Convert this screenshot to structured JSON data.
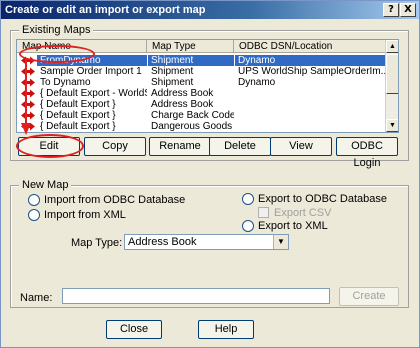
{
  "window": {
    "title": "Create or edit an import or export map",
    "help_label": "?",
    "close_label": "X"
  },
  "existing_maps": {
    "legend": "Existing Maps",
    "columns": [
      "Map Name",
      "Map Type",
      "ODBC DSN/Location"
    ],
    "rows": [
      {
        "name": "FromDynamo",
        "type": "Shipment",
        "location": "Dynamo",
        "selected": true
      },
      {
        "name": "Sample Order Import 1",
        "type": "Shipment",
        "location": "UPS WorldShip SampleOrderIm...",
        "selected": false
      },
      {
        "name": "To Dynamo",
        "type": "Shipment",
        "location": "Dynamo",
        "selected": false
      },
      {
        "name": "{ Default Export - WorldShip }",
        "type": "Address Book",
        "location": "",
        "selected": false
      },
      {
        "name": "{ Default Export }",
        "type": "Address Book",
        "location": "",
        "selected": false
      },
      {
        "name": "{ Default Export }",
        "type": "Charge Back Code",
        "location": "",
        "selected": false
      },
      {
        "name": "{ Default Export }",
        "type": "Dangerous Goods",
        "location": "",
        "selected": false
      }
    ],
    "buttons": {
      "edit": "Edit",
      "copy": "Copy",
      "rename": "Rename",
      "delete": "Delete",
      "view": "View",
      "odbc_login": "ODBC Login"
    }
  },
  "new_map": {
    "legend": "New Map",
    "import_odbc": "Import from ODBC Database",
    "import_xml": "Import from XML",
    "export_odbc": "Export to ODBC Database",
    "export_csv": "Export CSV",
    "export_xml": "Export to XML",
    "map_type_label": "Map Type:",
    "map_type_value": "Address Book",
    "name_label": "Name:",
    "name_value": "",
    "create_label": "Create"
  },
  "footer": {
    "close": "Close",
    "help": "Help"
  },
  "colors": {
    "selection": "#316ac5",
    "annotation": "#e02020",
    "row_icon": "#cc1010"
  }
}
